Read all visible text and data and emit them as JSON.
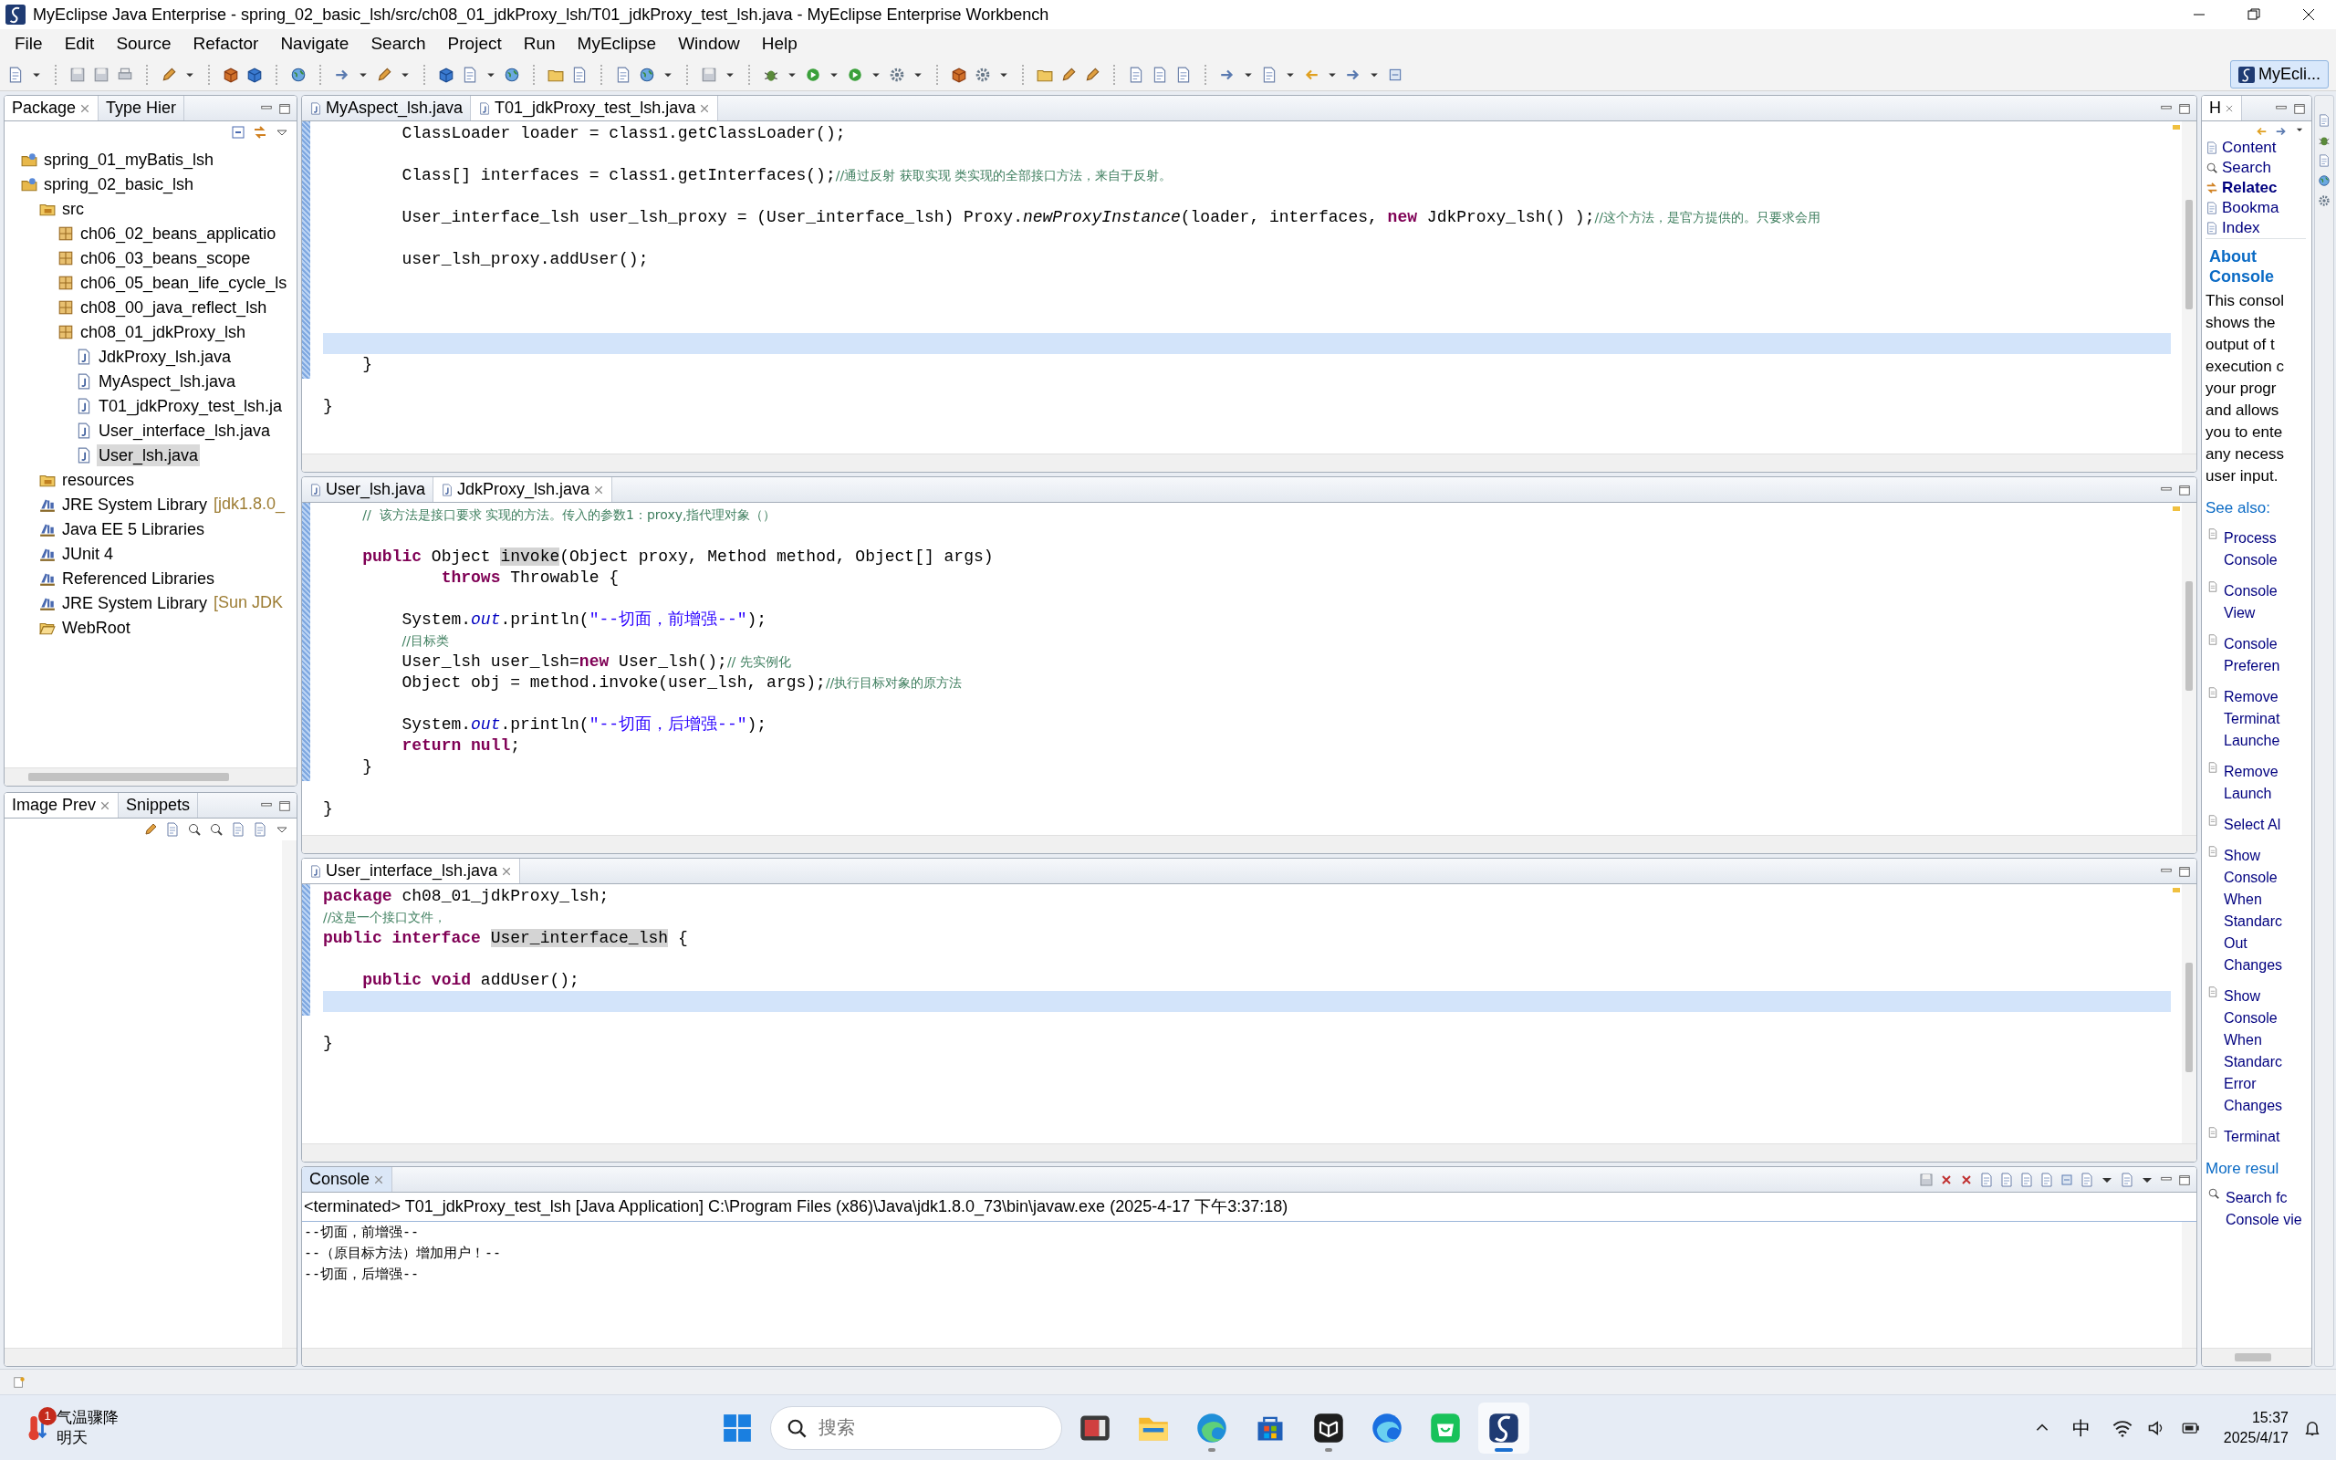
{
  "window": {
    "title": "MyEclipse Java Enterprise - spring_02_basic_lsh/src/ch08_01_jdkProxy_lsh/T01_jdkProxy_test_lsh.java - MyEclipse Enterprise Workbench"
  },
  "menu": [
    "File",
    "Edit",
    "Source",
    "Refactor",
    "Navigate",
    "Search",
    "Project",
    "Run",
    "MyEclipse",
    "Window",
    "Help"
  ],
  "perspective": {
    "label": "MyEcli...",
    "selected": true
  },
  "package_explorer": {
    "tabs": [
      {
        "label": "Package",
        "selected": true
      },
      {
        "label": "Type Hier",
        "selected": false
      }
    ],
    "tree": [
      {
        "label": "spring_01_myBatis_lsh",
        "kind": "project",
        "selected": false
      },
      {
        "label": "spring_02_basic_lsh",
        "kind": "project",
        "selected": false,
        "children": [
          {
            "label": "src",
            "kind": "source-folder",
            "selected": false,
            "children": [
              {
                "label": "ch06_02_beans_applicatio",
                "kind": "package",
                "selected": false
              },
              {
                "label": "ch06_03_beans_scope",
                "kind": "package",
                "selected": false
              },
              {
                "label": "ch06_05_bean_life_cycle_ls",
                "kind": "package",
                "selected": false
              },
              {
                "label": "ch08_00_java_reflect_lsh",
                "kind": "package",
                "selected": false
              },
              {
                "label": "ch08_01_jdkProxy_lsh",
                "kind": "package",
                "selected": false,
                "children": [
                  {
                    "label": "JdkProxy_lsh.java",
                    "kind": "file",
                    "selected": false
                  },
                  {
                    "label": "MyAspect_lsh.java",
                    "kind": "file",
                    "selected": false
                  },
                  {
                    "label": "T01_jdkProxy_test_lsh.ja",
                    "kind": "file",
                    "selected": false
                  },
                  {
                    "label": "User_interface_lsh.java",
                    "kind": "file",
                    "selected": false
                  },
                  {
                    "label": "User_lsh.java",
                    "kind": "file",
                    "selected": true
                  }
                ]
              }
            ]
          },
          {
            "label": "resources",
            "kind": "source-folder",
            "selected": false
          },
          {
            "label": "JRE System Library",
            "kind": "library",
            "selected": false,
            "decoration": "[jdk1.8.0_"
          },
          {
            "label": "Java EE 5 Libraries",
            "kind": "library",
            "selected": false
          },
          {
            "label": "JUnit 4",
            "kind": "library",
            "selected": false
          },
          {
            "label": "Referenced Libraries",
            "kind": "library",
            "selected": false
          },
          {
            "label": "JRE System Library",
            "kind": "library",
            "selected": false,
            "decoration": "[Sun JDK"
          },
          {
            "label": "WebRoot",
            "kind": "folder",
            "selected": false
          }
        ]
      }
    ]
  },
  "image_preview": {
    "tabs": [
      {
        "label": "Image Prev",
        "selected": true
      },
      {
        "label": "Snippets",
        "selected": false
      }
    ]
  },
  "editors": [
    {
      "tabs": [
        {
          "label": "MyAspect_lsh.java",
          "selected": false
        },
        {
          "label": "T01_jdkProxy_test_lsh.java",
          "selected": true
        }
      ],
      "lines": [
        {
          "current": false,
          "parts": [
            {
              "kind": "plain",
              "text": "        ClassLoader loader = class1.getClassLoader();"
            }
          ]
        },
        {
          "current": false
        },
        {
          "current": false,
          "parts": [
            {
              "kind": "plain",
              "text": "        Class[] interfaces = class1.getInterfaces();"
            },
            {
              "kind": "comment",
              "text": "//通过反射 获取实现 类实现的全部接口方法，来自于反射。"
            }
          ]
        },
        {
          "current": false
        },
        {
          "current": false,
          "parts": [
            {
              "kind": "plain",
              "text": "        User_interface_lsh user_lsh_proxy = (User_interface_lsh) Proxy."
            },
            {
              "kind": "static",
              "text": "newProxyInstance"
            },
            {
              "kind": "plain",
              "text": "(loader, interfaces, "
            },
            {
              "kind": "keyword",
              "text": "new"
            },
            {
              "kind": "plain",
              "text": " JdkProxy_lsh() );"
            },
            {
              "kind": "comment",
              "text": "//这个方法，是官方提供的。只要求会用"
            }
          ]
        },
        {
          "current": false
        },
        {
          "current": false,
          "parts": [
            {
              "kind": "plain",
              "text": "        user_lsh_proxy.addUser();"
            }
          ]
        },
        {
          "current": false
        },
        {
          "current": false
        },
        {
          "current": false
        },
        {
          "current": true
        },
        {
          "current": false,
          "parts": [
            {
              "kind": "plain",
              "text": "    }"
            }
          ]
        },
        {
          "current": false
        },
        {
          "current": false,
          "parts": [
            {
              "kind": "plain",
              "text": "}"
            }
          ]
        }
      ]
    },
    {
      "tabs": [
        {
          "label": "User_lsh.java",
          "selected": false
        },
        {
          "label": "JdkProxy_lsh.java",
          "selected": true
        }
      ],
      "lines": [
        {
          "current": false,
          "parts": [
            {
              "kind": "comment",
              "text": "    //  该方法是接口要求 实现的方法。传入的参数1：proxy,指代理对象（）"
            }
          ]
        },
        {
          "current": false
        },
        {
          "current": false,
          "parts": [
            {
              "kind": "keyword",
              "text": "    public"
            },
            {
              "kind": "plain",
              "text": " Object "
            },
            {
              "kind": "occurrence",
              "text": "invoke"
            },
            {
              "kind": "plain",
              "text": "(Object proxy, Method method, Object[] args)"
            }
          ]
        },
        {
          "current": false,
          "parts": [
            {
              "kind": "keyword",
              "text": "            throws"
            },
            {
              "kind": "plain",
              "text": " Throwable {"
            }
          ]
        },
        {
          "current": false
        },
        {
          "current": false,
          "parts": [
            {
              "kind": "plain",
              "text": "        System."
            },
            {
              "kind": "field",
              "text": "out"
            },
            {
              "kind": "plain",
              "text": ".println("
            },
            {
              "kind": "string",
              "text": "\"--切面，前增强--\""
            },
            {
              "kind": "plain",
              "text": ");"
            }
          ]
        },
        {
          "current": false,
          "parts": [
            {
              "kind": "comment",
              "text": "        //目标类"
            }
          ]
        },
        {
          "current": false,
          "parts": [
            {
              "kind": "plain",
              "text": "        User_lsh user_lsh="
            },
            {
              "kind": "keyword",
              "text": "new"
            },
            {
              "kind": "plain",
              "text": " User_lsh();"
            },
            {
              "kind": "comment",
              "text": "// 先实例化"
            }
          ]
        },
        {
          "current": false,
          "parts": [
            {
              "kind": "plain",
              "text": "        Object obj = method.invoke(user_lsh, args);"
            },
            {
              "kind": "comment",
              "text": "//执行目标对象的原方法"
            }
          ]
        },
        {
          "current": false
        },
        {
          "current": false,
          "parts": [
            {
              "kind": "plain",
              "text": "        System."
            },
            {
              "kind": "field",
              "text": "out"
            },
            {
              "kind": "plain",
              "text": ".println("
            },
            {
              "kind": "string",
              "text": "\"--切面，后增强--\""
            },
            {
              "kind": "plain",
              "text": ");"
            }
          ]
        },
        {
          "current": false,
          "parts": [
            {
              "kind": "keyword",
              "text": "        return null"
            },
            {
              "kind": "plain",
              "text": ";"
            }
          ]
        },
        {
          "current": false,
          "parts": [
            {
              "kind": "plain",
              "text": "    }"
            }
          ]
        },
        {
          "current": false
        },
        {
          "current": false,
          "parts": [
            {
              "kind": "plain",
              "text": "}"
            }
          ]
        }
      ]
    },
    {
      "tabs": [
        {
          "label": "User_interface_lsh.java",
          "selected": true
        }
      ],
      "lines": [
        {
          "current": false,
          "parts": [
            {
              "kind": "keyword",
              "text": "package"
            },
            {
              "kind": "plain",
              "text": " ch08_01_jdkProxy_lsh;"
            }
          ]
        },
        {
          "current": false,
          "parts": [
            {
              "kind": "comment",
              "text": "//这是一个接口文件，"
            }
          ]
        },
        {
          "current": false,
          "parts": [
            {
              "kind": "keyword",
              "text": "public interface "
            },
            {
              "kind": "occurrence",
              "text": "User_interface_lsh"
            },
            {
              "kind": "plain",
              "text": " {"
            }
          ]
        },
        {
          "current": false
        },
        {
          "current": false,
          "parts": [
            {
              "kind": "keyword",
              "text": "    public void"
            },
            {
              "kind": "plain",
              "text": " addUser();"
            }
          ]
        },
        {
          "current": true
        },
        {
          "current": false
        },
        {
          "current": false,
          "parts": [
            {
              "kind": "plain",
              "text": "}"
            }
          ]
        }
      ]
    }
  ],
  "console": {
    "tab": {
      "label": "Console",
      "selected": true
    },
    "header": "<terminated> T01_jdkProxy_test_lsh [Java Application] C:\\Program Files (x86)\\Java\\jdk1.8.0_73\\bin\\javaw.exe (2025-4-17 下午3:37:18)",
    "output": [
      "--切面，前增强--",
      "--（原目标方法）增加用户！--",
      "--切面，后增强--"
    ]
  },
  "help": {
    "tab": {
      "label": "H",
      "selected": true
    },
    "links": [
      {
        "label": "Content",
        "selected": false
      },
      {
        "label": "Search",
        "selected": false
      },
      {
        "label": "Relatec",
        "selected": true
      },
      {
        "label": "Bookma",
        "selected": false
      },
      {
        "label": "Index",
        "selected": false
      }
    ],
    "heading": "About Console",
    "description_lines": [
      "This consol",
      "shows the",
      "output of t",
      "execution c",
      "your progr",
      "and allows",
      "you to ente",
      "any necess",
      "user input."
    ],
    "see_also": "See also:",
    "topics": [
      {
        "lines": [
          "Process",
          "Console"
        ]
      },
      {
        "lines": [
          "Console",
          "View"
        ]
      },
      {
        "lines": [
          "Console",
          "Preferen"
        ]
      },
      {
        "lines": [
          "Remove",
          "Terminat",
          "Launche"
        ]
      },
      {
        "lines": [
          "Remove",
          "Launch"
        ]
      },
      {
        "lines": [
          "Select Al"
        ]
      },
      {
        "lines": [
          "Show",
          "Console",
          "When",
          "Standarc",
          "Out",
          "Changes"
        ]
      },
      {
        "lines": [
          "Show",
          "Console",
          "When",
          "Standarc",
          "Error",
          "Changes"
        ]
      },
      {
        "lines": [
          "Terminat"
        ]
      }
    ],
    "more": "More resul",
    "search_lines": [
      "Search fc",
      "Console vie"
    ]
  },
  "taskbar": {
    "weather": {
      "badge": "1",
      "title": "气温骤降",
      "subtitle": "明天"
    },
    "search": {
      "placeholder": "搜索"
    },
    "apps": [
      {
        "kind": "photo",
        "running": false,
        "active": false
      },
      {
        "kind": "folder",
        "running": false,
        "active": false
      },
      {
        "kind": "browser",
        "running": true,
        "active": false
      },
      {
        "kind": "store",
        "running": false,
        "active": false
      },
      {
        "kind": "cube",
        "running": true,
        "active": false
      },
      {
        "kind": "browser-ai",
        "running": false,
        "active": false
      },
      {
        "kind": "bag",
        "running": false,
        "active": false
      },
      {
        "kind": "swirl",
        "running": true,
        "active": true
      }
    ],
    "ime": "中",
    "time": "15:37",
    "date": "2025/4/17"
  }
}
